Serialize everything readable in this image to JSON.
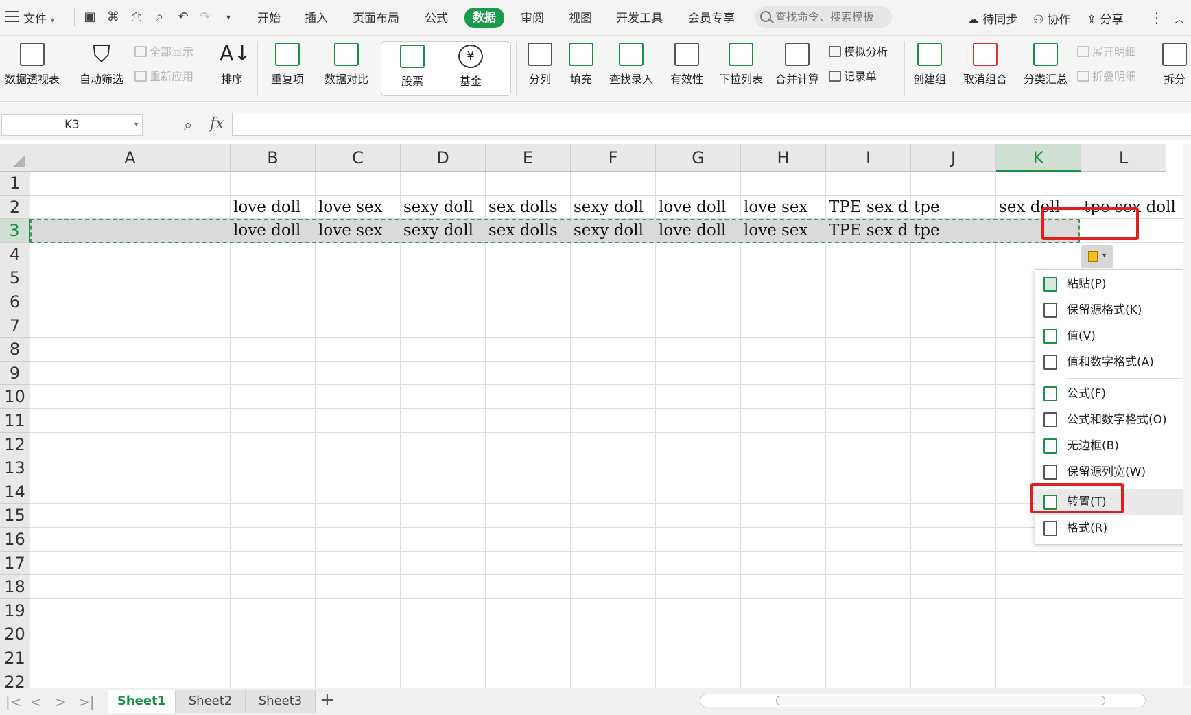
{
  "menubar": {
    "file_label": "文件",
    "tabs": [
      "开始",
      "插入",
      "页面布局",
      "公式",
      "数据",
      "审阅",
      "视图",
      "开发工具",
      "会员专享"
    ],
    "active_tab": "数据",
    "search_placeholder": "查找命令、搜索模板",
    "sync_label": "待同步",
    "collab_label": "协作",
    "share_label": "分享"
  },
  "ribbon": {
    "pivot": "数据透视表",
    "autofilter": "自动筛选",
    "show_all": "全部显示",
    "reapply": "重新应用",
    "sort": "排序",
    "duplicates": "重复项",
    "compare": "数据对比",
    "stock": "股票",
    "fund": "基金",
    "split": "分列",
    "fill": "填充",
    "lookup": "查找录入",
    "validity": "有效性",
    "dropdown": "下拉列表",
    "consolidate": "合并计算",
    "whatif": "模拟分析",
    "record": "记录单",
    "group": "创建组",
    "ungroup": "取消组合",
    "subtotal": "分类汇总",
    "expand": "展开明细",
    "collapse": "折叠明细",
    "split2": "拆分"
  },
  "formula_bar": {
    "cell_ref": "K3",
    "fx": "fx",
    "value": ""
  },
  "grid": {
    "columns": [
      "A",
      "B",
      "C",
      "D",
      "E",
      "F",
      "G",
      "H",
      "I",
      "J",
      "K",
      "L"
    ],
    "selected_column": "K",
    "rows": [
      "1",
      "2",
      "3",
      "4",
      "5",
      "6",
      "7",
      "8",
      "9",
      "10",
      "11",
      "12",
      "13",
      "14",
      "15",
      "16",
      "17",
      "18",
      "19",
      "20",
      "21",
      "22"
    ],
    "selected_row": "3",
    "row2": {
      "B": "love doll",
      "C": "love sex",
      "D": "sexy doll",
      "E": "sex dolls",
      "F": "sexy doll",
      "G": "love doll",
      "H": "love sex",
      "I": "TPE sex d",
      "J": "tpe",
      "K": "sex doll",
      "L": "tpe sex doll"
    },
    "row3": {
      "B": "love doll",
      "C": "love sex",
      "D": "sexy doll",
      "E": "sex dolls",
      "F": "sexy doll",
      "G": "love doll",
      "H": "love sex",
      "I": "TPE sex d",
      "J": "tpe"
    }
  },
  "paste_menu": {
    "items": [
      "粘贴(P)",
      "保留源格式(K)",
      "值(V)",
      "值和数字格式(A)",
      "公式(F)",
      "公式和数字格式(O)",
      "无边框(B)",
      "保留源列宽(W)",
      "转置(T)",
      "格式(R)"
    ],
    "highlighted": "转置(T)"
  },
  "sheets": {
    "tabs": [
      "Sheet1",
      "Sheet2",
      "Sheet3"
    ],
    "active": "Sheet1",
    "add": "+"
  },
  "colors": {
    "accent": "#1b9a4b",
    "highlight_box": "#e02020",
    "selection_fill": "#dadada"
  }
}
